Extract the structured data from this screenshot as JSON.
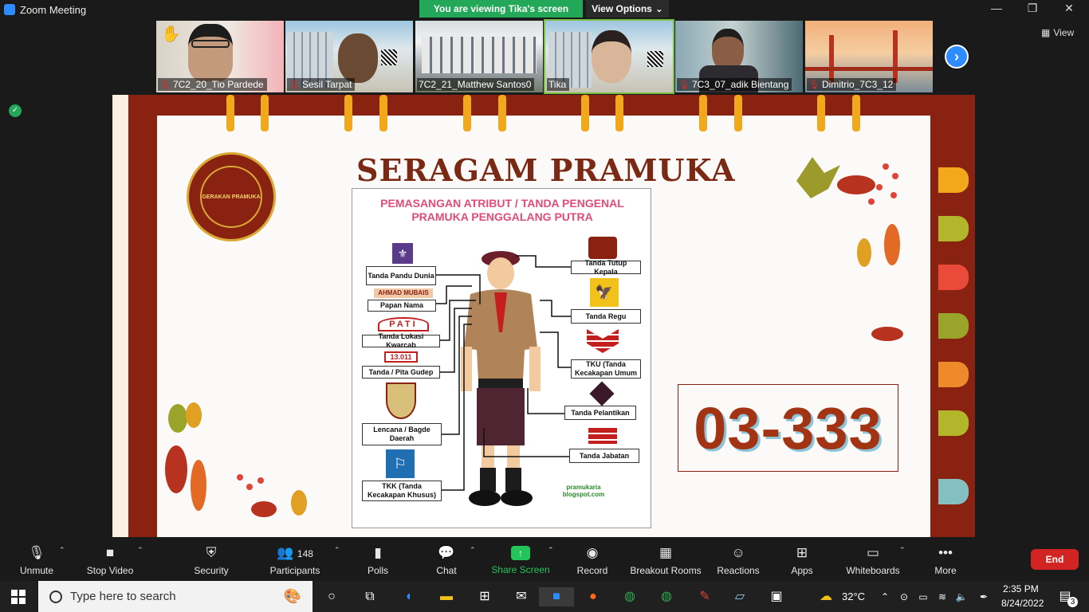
{
  "window": {
    "title": "Zoom Meeting"
  },
  "banner": {
    "viewing": "You are viewing Tika's screen",
    "view_options": "View Options"
  },
  "gallery": {
    "view_label": "View",
    "tiles": [
      {
        "name": "7C2_20_Tio Pardede"
      },
      {
        "name": "Sesil Tarpat"
      },
      {
        "name": "7C2_21_Matthew Santos0"
      },
      {
        "name": "Tika"
      },
      {
        "name": "7C3_07_adik Bientang"
      },
      {
        "name": "Dimitrio_7C3_12"
      }
    ]
  },
  "slide": {
    "title": "SERAGAM PRAMUKA",
    "emblem_text": "GERAKAN PRAMUKA",
    "poster": {
      "title_line1": "PEMASANGAN ATRIBUT / TANDA PENGENAL",
      "title_line2": "PRAMUKA PENGGALANG PUTRA",
      "nametag": "AHMAD MUBAIS",
      "pati": "PATI",
      "gudep": "13.011",
      "left_labels": [
        "Tanda Pandu Dunia",
        "Papan Nama",
        "Tanda Lokasi Kwarcab",
        "Tanda / Pita Gudep",
        "Lencana / Bagde Daerah",
        "TKK (Tanda Kecakapan Khusus)"
      ],
      "right_labels": [
        "Tanda Tutup Kepala",
        "Tanda Regu",
        "TKU (Tanda Kecakapan Umum",
        "Tanda Pelantikan",
        "Tanda Jabatan"
      ],
      "credit": "pramukaria blogspot.com"
    },
    "code": "03-333"
  },
  "toolbar": {
    "unmute": "Unmute",
    "stop_video": "Stop Video",
    "security": "Security",
    "participants": "Participants",
    "participants_count": "148",
    "polls": "Polls",
    "chat": "Chat",
    "share_screen": "Share Screen",
    "record": "Record",
    "breakout_rooms": "Breakout Rooms",
    "reactions": "Reactions",
    "apps": "Apps",
    "whiteboards": "Whiteboards",
    "more": "More",
    "end": "End"
  },
  "taskbar": {
    "search_placeholder": "Type here to search",
    "temperature": "32°C",
    "time": "2:35 PM",
    "date": "8/24/2022",
    "notifications": "3"
  },
  "colors": {
    "zoom_blue": "#2d8cff",
    "banner_green": "#23a85a",
    "end_red": "#d32424",
    "slide_frame": "#8a2212"
  }
}
